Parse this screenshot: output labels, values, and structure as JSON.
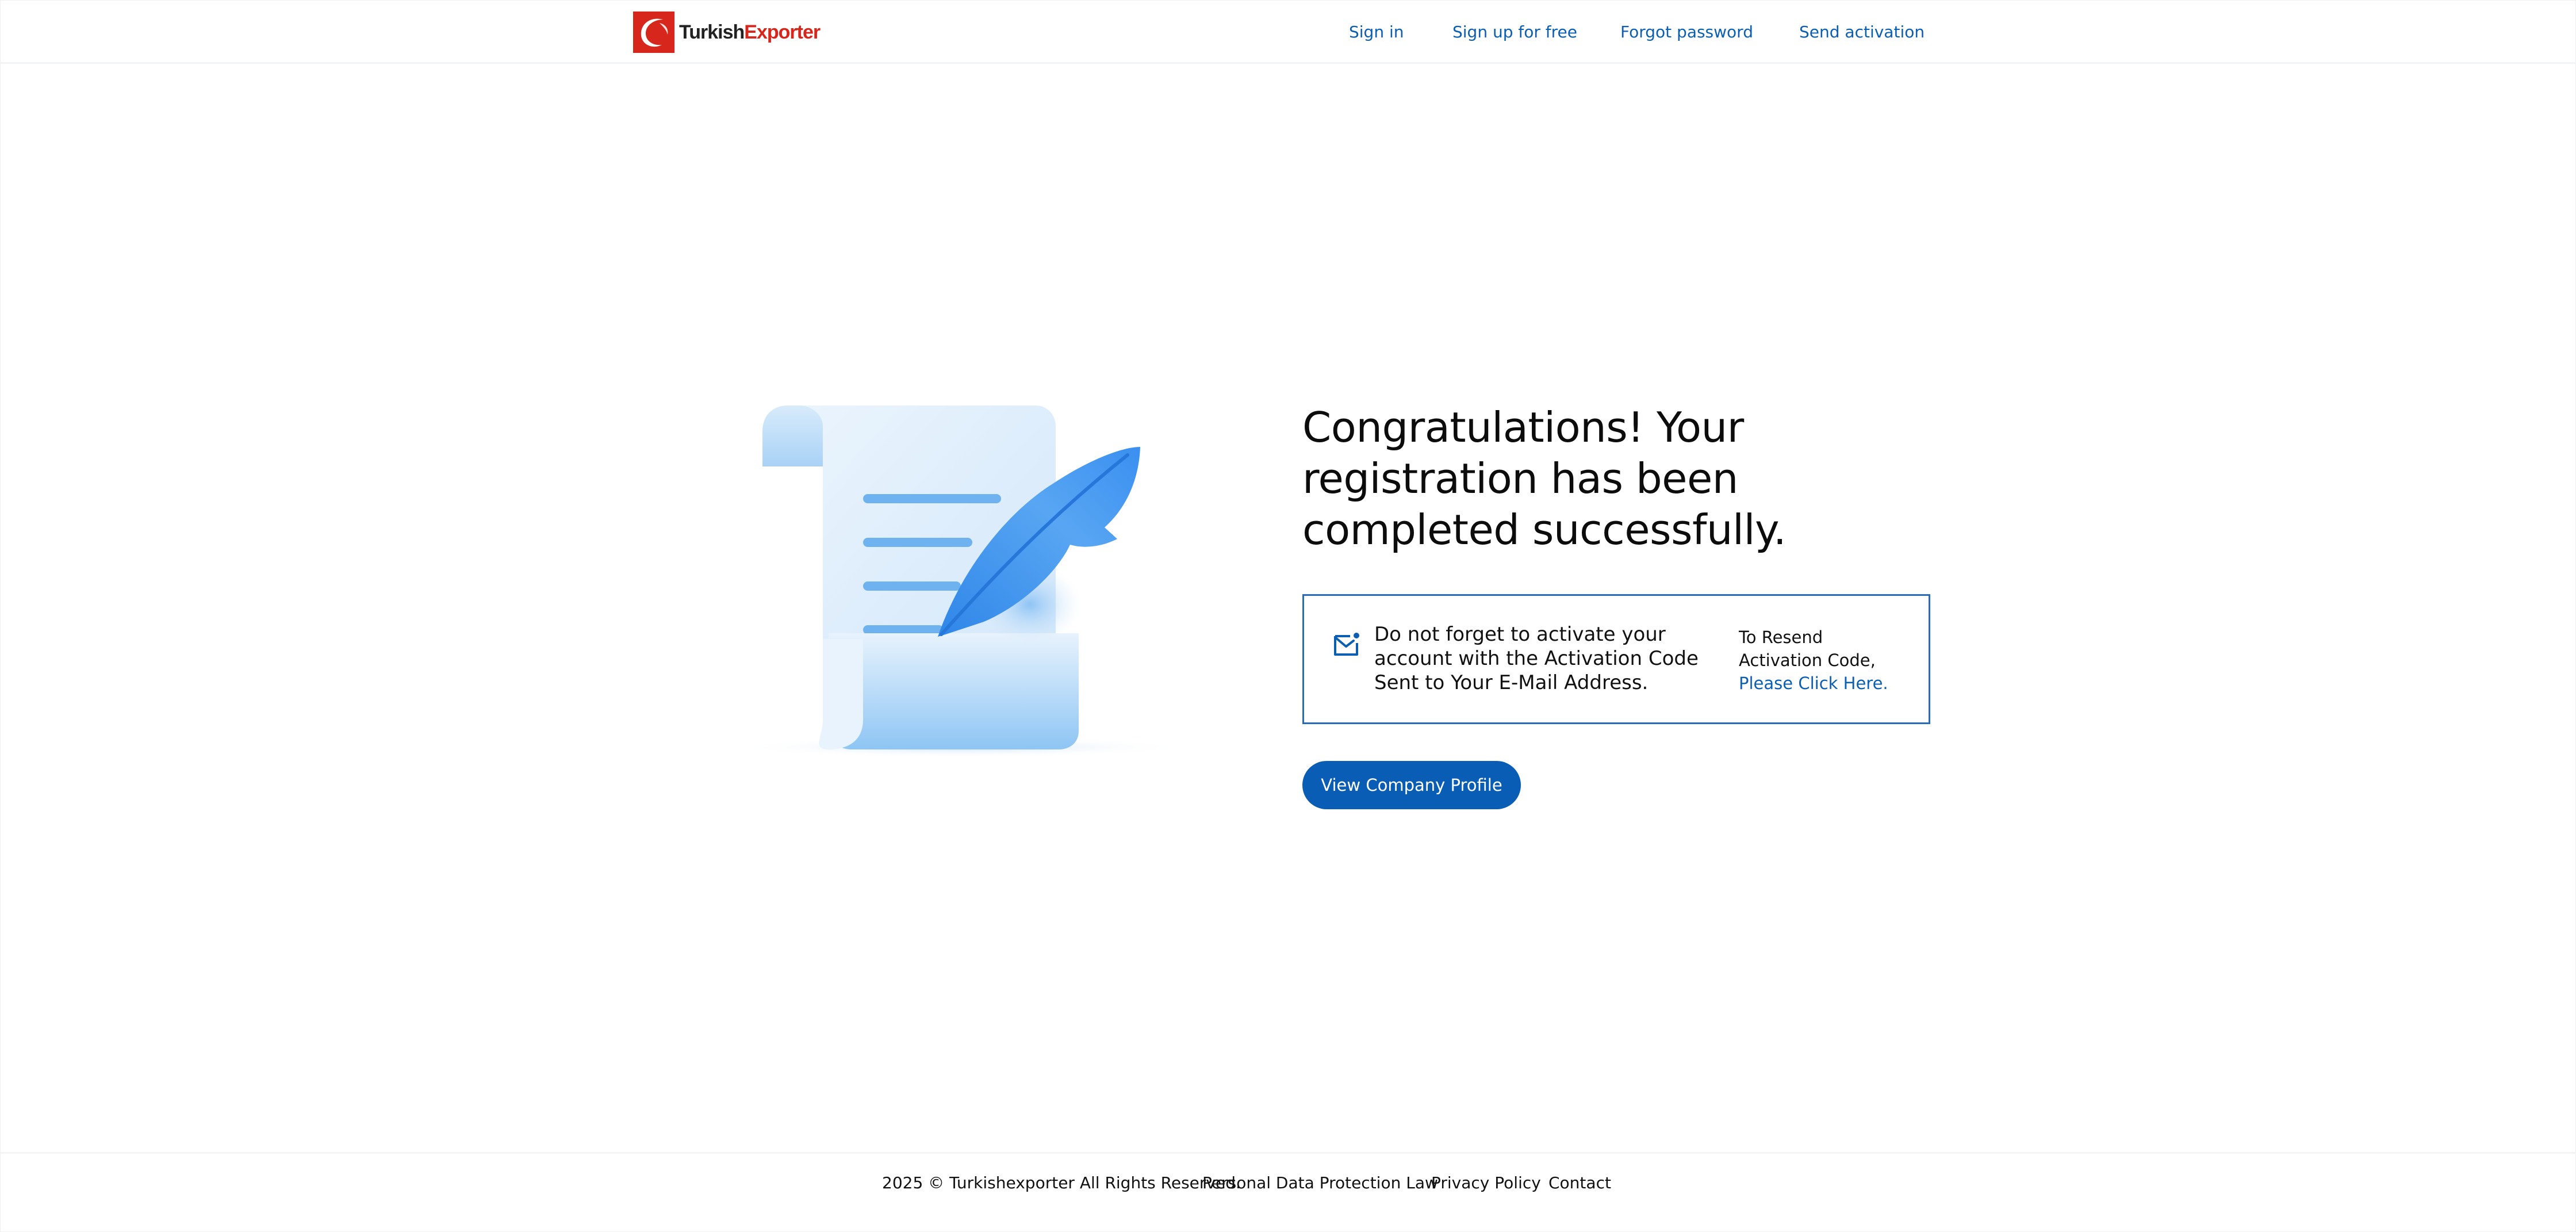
{
  "header": {
    "logo": {
      "part1": "Turkish",
      "part2": "Exporter"
    },
    "nav": [
      {
        "label": "Sign in"
      },
      {
        "label": "Sign up for free"
      },
      {
        "label": "Forgot password"
      },
      {
        "label": "Send activation"
      }
    ]
  },
  "main": {
    "title_line1": "Congratulations! Your",
    "title_line2": "registration has been",
    "title_line3": "completed successfully.",
    "notice": {
      "icon": "mail-notification-icon",
      "text": "Do not forget to activate your account with the Activation Code Sent to Your E-Mail Address.",
      "resend_prefix": "To Resend Activation Code,",
      "resend_link": "Please Click Here."
    },
    "profile_button": "View Company Profile",
    "illustration": "document-quill-illustration"
  },
  "footer": {
    "copyright": "2025 © Turkishexporter All Rights Reserved.",
    "links": [
      {
        "label": "Personal Data Protection Law"
      },
      {
        "label": "Privacy Policy"
      },
      {
        "label": "Contact"
      }
    ]
  },
  "colors": {
    "brand_red": "#d7261c",
    "link_blue": "#0b5fb3",
    "button_blue": "#0a5db4",
    "notice_border": "#2a6cb8"
  }
}
